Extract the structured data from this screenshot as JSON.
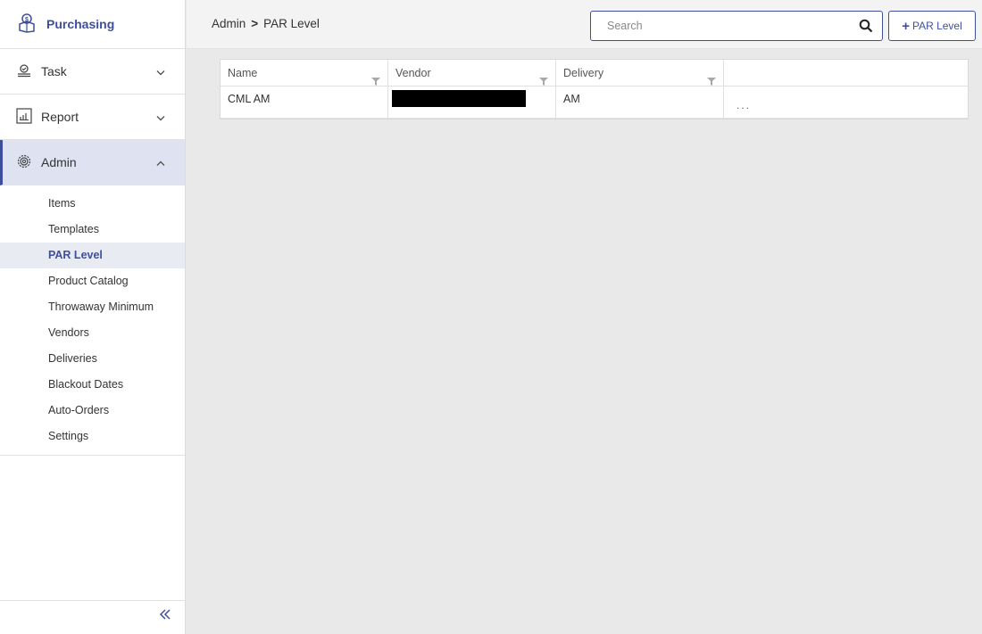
{
  "app": {
    "title": "Purchasing"
  },
  "nav": {
    "task_label": "Task",
    "report_label": "Report",
    "admin_label": "Admin",
    "admin_items": [
      "Items",
      "Templates",
      "PAR Level",
      "Product Catalog",
      "Throwaway Minimum",
      "Vendors",
      "Deliveries",
      "Blackout Dates",
      "Auto-Orders",
      "Settings"
    ]
  },
  "header": {
    "breadcrumb_parent": "Admin",
    "breadcrumb_separator": ">",
    "breadcrumb_current": "PAR Level",
    "search_placeholder": "Search",
    "add_button_label": "PAR Level",
    "add_button_plus": "+"
  },
  "table": {
    "columns": [
      "Name",
      "Vendor",
      "Delivery",
      ""
    ],
    "rows": [
      {
        "name": "CML AM",
        "vendor": "",
        "delivery": "AM",
        "actions": "..."
      }
    ]
  },
  "colors": {
    "accent": "#3f4fa0",
    "active_bg": "#dfe3f1"
  },
  "icons": {
    "brand": "purchasing-box-icon",
    "task": "task-icon",
    "report": "report-chart-icon",
    "admin": "gear-icon",
    "search": "search-icon",
    "filter": "filter-icon",
    "collapse": "double-chevron-left-icon"
  }
}
